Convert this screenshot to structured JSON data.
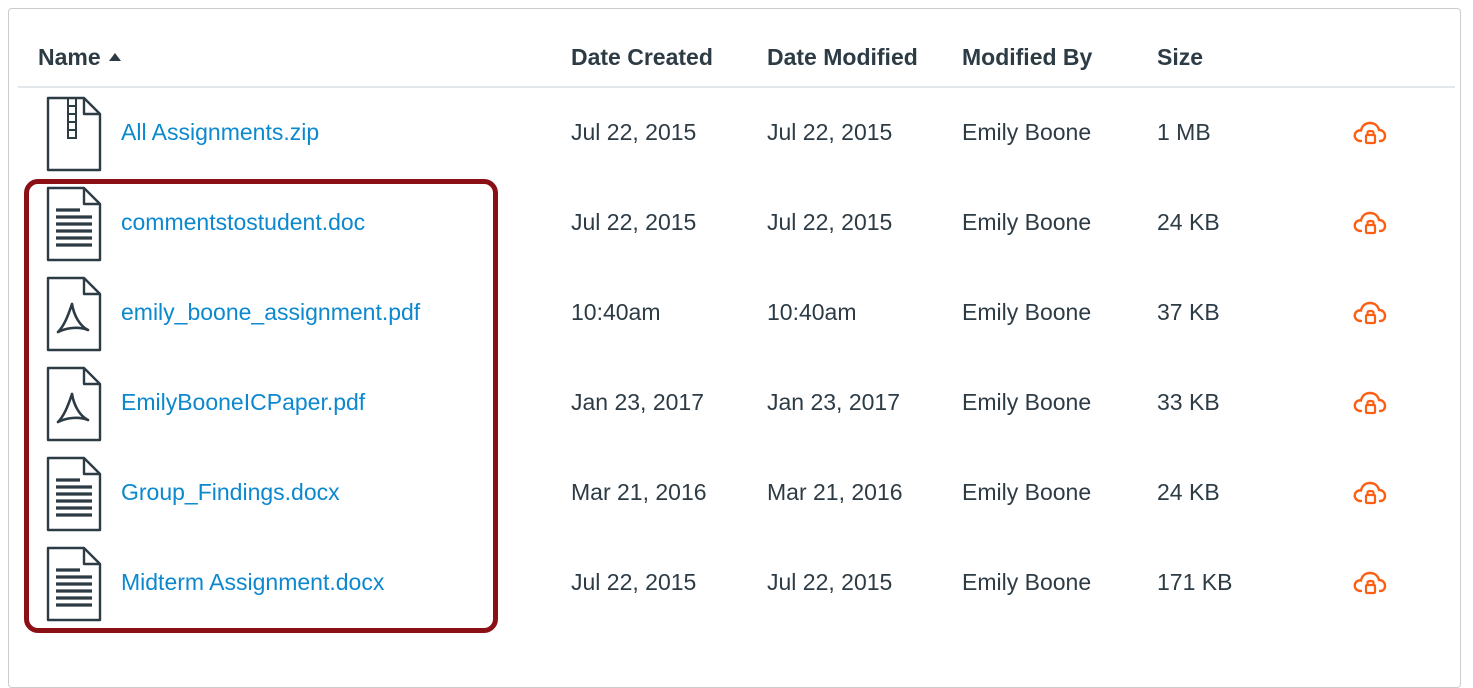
{
  "table": {
    "columns": {
      "name": "Name",
      "date_created": "Date Created",
      "date_modified": "Date Modified",
      "modified_by": "Modified By",
      "size": "Size"
    },
    "sort_column": "Name",
    "sort_direction": "ascending",
    "rows": [
      {
        "name": "All Assignments.zip",
        "type": "zip",
        "date_created": "Jul 22, 2015",
        "date_modified": "Jul 22, 2015",
        "modified_by": "Emily Boone",
        "size": "1 MB"
      },
      {
        "name": "commentstostudent.doc",
        "type": "doc",
        "date_created": "Jul 22, 2015",
        "date_modified": "Jul 22, 2015",
        "modified_by": "Emily Boone",
        "size": "24 KB"
      },
      {
        "name": "emily_boone_assignment.pdf",
        "type": "pdf",
        "date_created": "10:40am",
        "date_modified": "10:40am",
        "modified_by": "Emily Boone",
        "size": "37 KB"
      },
      {
        "name": "EmilyBooneICPaper.pdf",
        "type": "pdf",
        "date_created": "Jan 23, 2017",
        "date_modified": "Jan 23, 2017",
        "modified_by": "Emily Boone",
        "size": "33 KB"
      },
      {
        "name": "Group_Findings.docx",
        "type": "doc",
        "date_created": "Mar 21, 2016",
        "date_modified": "Mar 21, 2016",
        "modified_by": "Emily Boone",
        "size": "24 KB"
      },
      {
        "name": "Midterm Assignment.docx",
        "type": "doc",
        "date_created": "Jul 22, 2015",
        "date_modified": "Jul 22, 2015",
        "modified_by": "Emily Boone",
        "size": "171 KB"
      }
    ]
  },
  "colors": {
    "link": "#0c88cf",
    "text": "#2d3b45",
    "publish_icon": "#fc5e13",
    "highlight_border": "#8b1016"
  },
  "icons": {
    "zip": "zip-file-icon",
    "doc": "document-file-icon",
    "pdf": "pdf-file-icon",
    "publish": "cloud-lock-icon"
  }
}
